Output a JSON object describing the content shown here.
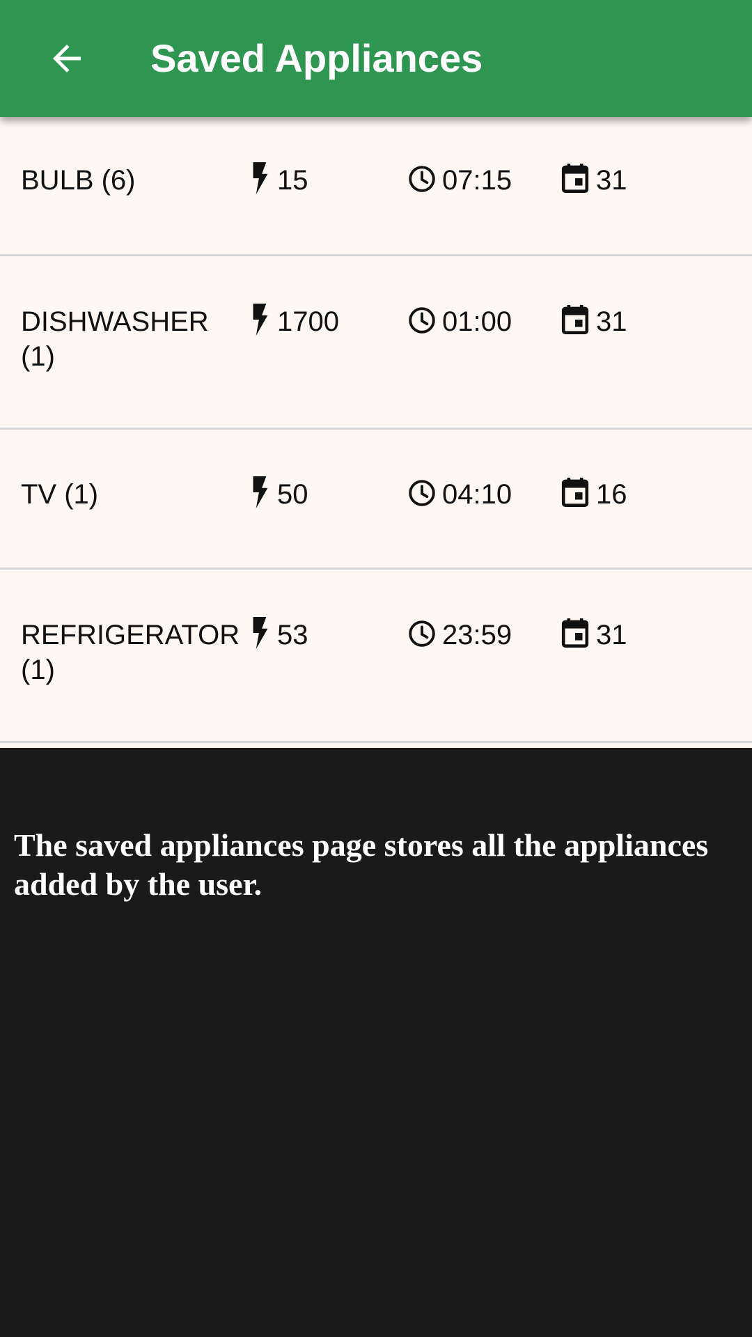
{
  "app_bar": {
    "title": "Saved Appliances",
    "back_icon": "arrow-back-icon",
    "color": "#2e9651"
  },
  "appliances": [
    {
      "name": "BULB (6)",
      "power": "15",
      "time": "07:15",
      "days": "31"
    },
    {
      "name": "DISHWASHER (1)",
      "power": "1700",
      "time": "01:00",
      "days": "31"
    },
    {
      "name": "TV (1)",
      "power": "50",
      "time": "04:10",
      "days": "16"
    },
    {
      "name": "REFRIGERATOR (1)",
      "power": "53",
      "time": "23:59",
      "days": "31"
    }
  ],
  "icons": {
    "power": "flash-icon",
    "time": "clock-icon",
    "days": "calendar-icon"
  },
  "caption": "The saved appliances page stores all the appliances added by the user."
}
